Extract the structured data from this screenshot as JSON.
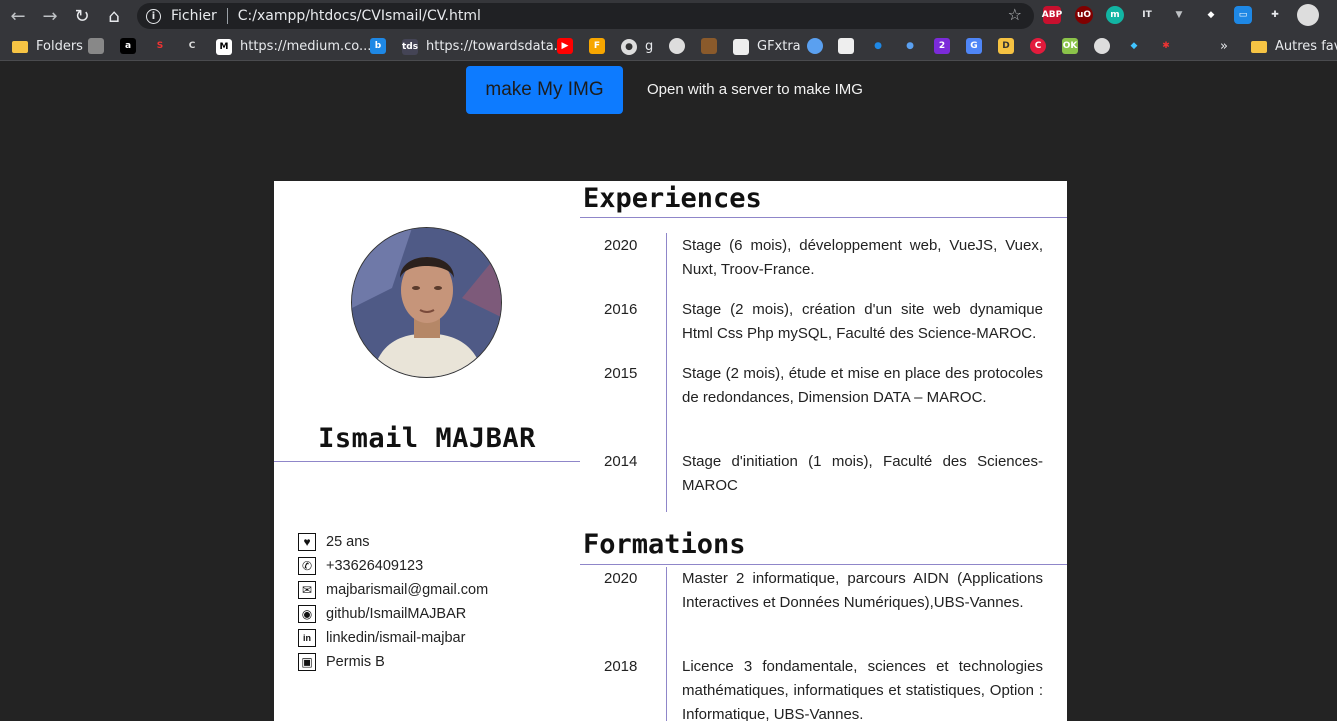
{
  "browser": {
    "scheme_label": "Fichier",
    "url": "C:/xampp/htdocs/CVIsmail/CV.html",
    "extensions": [
      "ABP",
      "uO",
      "m",
      "IT",
      "▼",
      "◆",
      "▭",
      "✚"
    ],
    "bookmarks": {
      "folders": "Folders",
      "medium": "https://medium.co...",
      "tds": "https://towardsdata...",
      "g": "g",
      "gfxtra": "GFxtra",
      "overflow": "»",
      "autres": "Autres favo"
    }
  },
  "toolbar": {
    "make_button": "make My IMG",
    "server_note": "Open with a server to make IMG"
  },
  "cv": {
    "name": "Ismail MAJBAR",
    "contacts": [
      {
        "icon": "heart-icon",
        "text": "25 ans"
      },
      {
        "icon": "phone-icon",
        "text": "+33626409123"
      },
      {
        "icon": "mail-icon",
        "text": "majbarismail@gmail.com"
      },
      {
        "icon": "github-icon",
        "text": "github/IsmailMAJBAR"
      },
      {
        "icon": "linkedin-icon",
        "text": "linkedin/ismail-majbar"
      },
      {
        "icon": "car-icon",
        "text": "Permis B"
      }
    ],
    "experiences_title": "Experiences",
    "experiences": [
      {
        "year": "2020",
        "text": "Stage (6 mois), développement web, VueJS, Vuex, Nuxt, Troov-France."
      },
      {
        "year": "2016",
        "text": "Stage (2 mois), création d'un site web dynamique Html Css Php mySQL, Faculté des Science-MAROC."
      },
      {
        "year": "2015",
        "text": "Stage (2 mois), étude et mise en place des protocoles de redondances, Dimension DATA – MAROC."
      },
      {
        "year": "2014",
        "text": "Stage d'initiation (1 mois), Faculté des Sciences-MAROC"
      }
    ],
    "formations_title": "Formations",
    "formations": [
      {
        "year": "2020",
        "text": "Master 2 informatique, parcours AIDN (Applications Interactives et Données Numériques),UBS-Vannes."
      },
      {
        "year": "2018",
        "text": "Licence 3 fondamentale, sciences et technologies mathématiques, informatiques et statistiques, Option : Informatique, UBS-Vannes."
      }
    ]
  }
}
